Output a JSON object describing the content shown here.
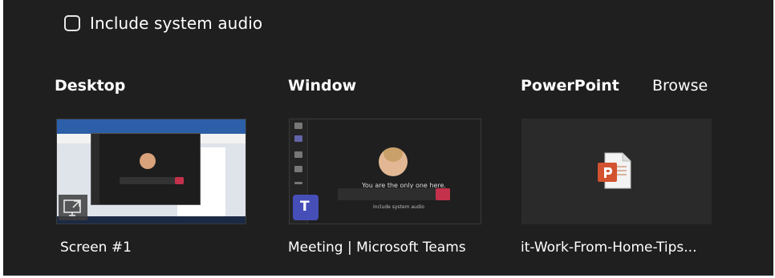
{
  "include_audio": {
    "label": "Include system audio",
    "checked": false
  },
  "sections": {
    "desktop": {
      "title": "Desktop",
      "item_label": "Screen #1"
    },
    "window": {
      "title": "Window",
      "item_label": "Meeting | Microsoft Teams",
      "preview_message": "You are the only one here.",
      "preview_checkbox": "Include system audio"
    },
    "powerpoint": {
      "title": "PowerPoint",
      "browse_label": "Browse",
      "item_label": "it-Work-From-Home-Tips..."
    }
  },
  "colors": {
    "panel_bg": "#1f1f1f",
    "teams_purple": "#464eb8",
    "end_call_red": "#c4314b",
    "ppt_orange": "#d35230"
  },
  "icons": {
    "screen": "screen-share-icon",
    "teams": "teams-logo-icon",
    "powerpoint": "powerpoint-file-icon"
  }
}
